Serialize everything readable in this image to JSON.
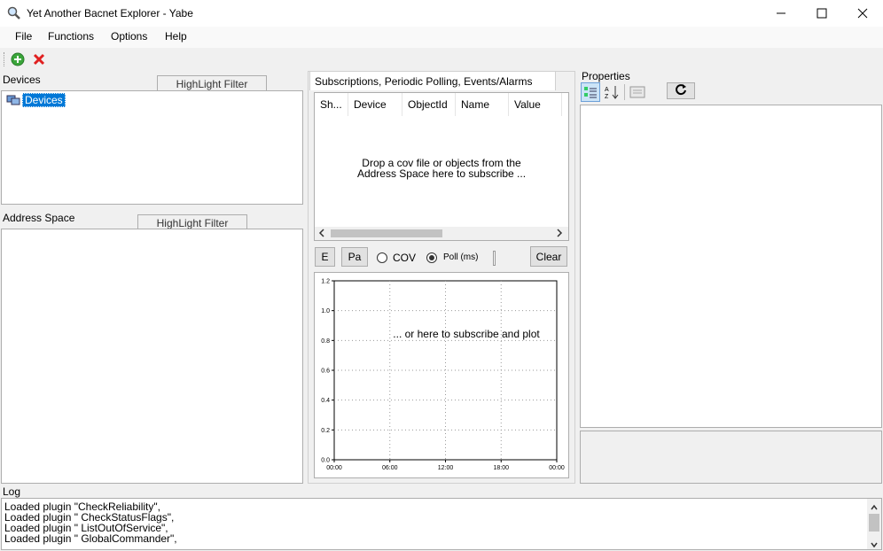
{
  "window": {
    "title": "Yet Another Bacnet Explorer - Yabe"
  },
  "menu": [
    "File",
    "Functions",
    "Options",
    "Help"
  ],
  "devices": {
    "label": "Devices",
    "filter": "HighLight Filter",
    "tree_root": "Devices"
  },
  "address_space": {
    "label": "Address Space",
    "filter": "HighLight Filter"
  },
  "subscriptions": {
    "tab": "Subscriptions, Periodic Polling, Events/Alarms",
    "columns": [
      "Sh...",
      "Device",
      "ObjectId",
      "Name",
      "Value"
    ],
    "drop_hint_line1": "Drop a cov file or objects from the",
    "drop_hint_line2": "Address Space here to subscribe ..."
  },
  "controls": {
    "e_label": "E",
    "pa_label": "Pa",
    "cov_label": "COV",
    "poll_label": "Poll (ms)",
    "clear_label": "Clear",
    "selected_mode": "Poll (ms)"
  },
  "chart_data": {
    "type": "line",
    "annotation": "... or here to subscribe and plot",
    "y_ticks": [
      "0.0",
      "0.2",
      "0.4",
      "0.6",
      "0.8",
      "1.0",
      "1.2"
    ],
    "x_ticks": [
      "00:00",
      "06:00",
      "12:00",
      "18:00",
      "00:00"
    ],
    "ylim": [
      0,
      1.2
    ],
    "grid": true,
    "series": []
  },
  "properties": {
    "label": "Properties"
  },
  "log": {
    "label": "Log",
    "lines": [
      "Loaded plugin \"CheckReliability\",",
      "Loaded plugin \" CheckStatusFlags\",",
      "Loaded plugin \" ListOutOfService\",",
      "Loaded plugin \" GlobalCommander\","
    ]
  },
  "colors": {
    "selection": "#0078d7",
    "add_icon": "#3aa53a",
    "remove_icon": "#e02020"
  }
}
